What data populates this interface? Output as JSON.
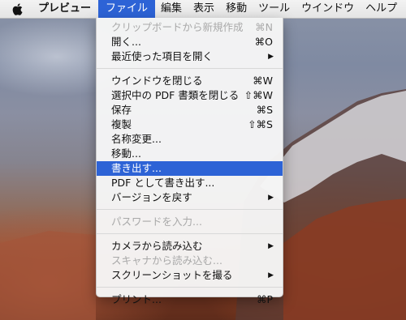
{
  "menubar": {
    "apple_icon": "apple-logo-icon",
    "items": [
      "プレビュー",
      "ファイル",
      "編集",
      "表示",
      "移動",
      "ツール",
      "ウインドウ",
      "ヘルプ"
    ]
  },
  "colors": {
    "highlight": "#2d63d6",
    "menu_background": "#f6f6f6",
    "disabled_text": "#a9a9a9"
  },
  "file_menu": {
    "items": [
      {
        "label": "クリップボードから新規作成",
        "shortcut": "⌘N",
        "enabled": false
      },
      {
        "label": "開く...",
        "shortcut": "⌘O",
        "enabled": true
      },
      {
        "label": "最近使った項目を開く",
        "submenu": "▶",
        "enabled": true
      },
      {
        "label": "ウインドウを閉じる",
        "shortcut": "⌘W",
        "enabled": true
      },
      {
        "label": "選択中の PDF 書類を閉じる",
        "shortcut": "⇧⌘W",
        "enabled": true
      },
      {
        "label": "保存",
        "shortcut": "⌘S",
        "enabled": true
      },
      {
        "label": "複製",
        "shortcut": "⇧⌘S",
        "enabled": true
      },
      {
        "label": "名称変更...",
        "enabled": true
      },
      {
        "label": "移動...",
        "enabled": true
      },
      {
        "label": "書き出す...",
        "enabled": true,
        "highlighted": true
      },
      {
        "label": "PDF として書き出す...",
        "enabled": true
      },
      {
        "label": "バージョンを戻す",
        "submenu": "▶",
        "enabled": true
      },
      {
        "label": "パスワードを入力...",
        "enabled": false
      },
      {
        "label": "カメラから読み込む",
        "submenu": "▶",
        "enabled": true
      },
      {
        "label": "スキャナから読み込む...",
        "enabled": false
      },
      {
        "label": "スクリーンショットを撮る",
        "submenu": "▶",
        "enabled": true
      },
      {
        "label": "プリント...",
        "shortcut": "⌘P",
        "enabled": true
      }
    ]
  }
}
